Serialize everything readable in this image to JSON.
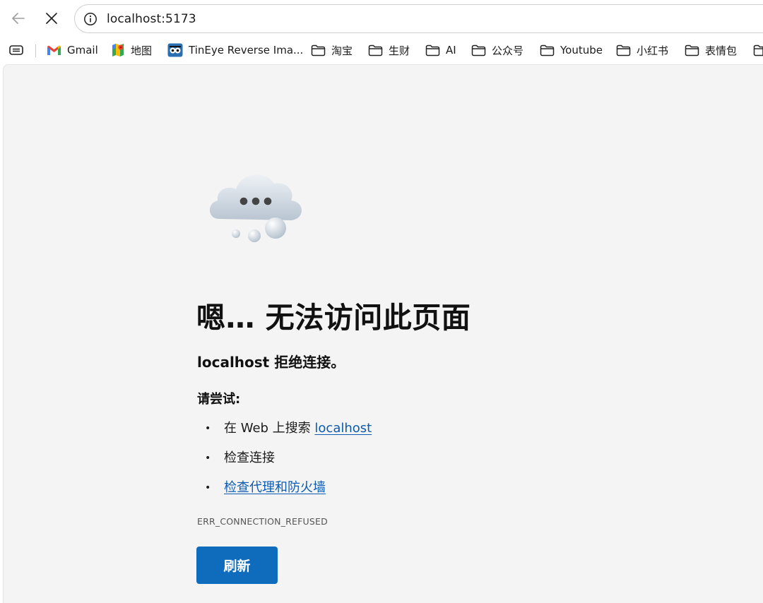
{
  "browser": {
    "url": "localhost:5173",
    "back_icon": "arrow-left-icon",
    "stop_icon": "close-x-icon",
    "info_icon": "info-circle-icon"
  },
  "bookmarks": {
    "items": [
      {
        "label": "Gmail",
        "icon": "gmail-icon"
      },
      {
        "label": "地图",
        "icon": "maps-icon"
      },
      {
        "label": "TinEye Reverse Ima...",
        "icon": "tineye-icon"
      },
      {
        "label": "淘宝",
        "icon": "folder-icon"
      },
      {
        "label": "生财",
        "icon": "folder-icon"
      },
      {
        "label": "AI",
        "icon": "folder-icon"
      },
      {
        "label": "公众号",
        "icon": "folder-icon"
      },
      {
        "label": "Youtube",
        "icon": "folder-icon"
      },
      {
        "label": "小红书",
        "icon": "folder-icon"
      },
      {
        "label": "表情包",
        "icon": "folder-icon"
      }
    ]
  },
  "error_page": {
    "title": "嗯… 无法访问此页面",
    "subtitle": "localhost 拒绝连接。",
    "try_heading": "请尝试:",
    "suggestions": {
      "item1_prefix": "在 Web 上搜索 ",
      "item1_link": "localhost",
      "item2": "检查连接",
      "item3_link": "检查代理和防火墙"
    },
    "error_code": "ERR_CONNECTION_REFUSED",
    "refresh_label": "刷新",
    "accent_color": "#0f6cbd",
    "link_color": "#0d5bb1"
  }
}
